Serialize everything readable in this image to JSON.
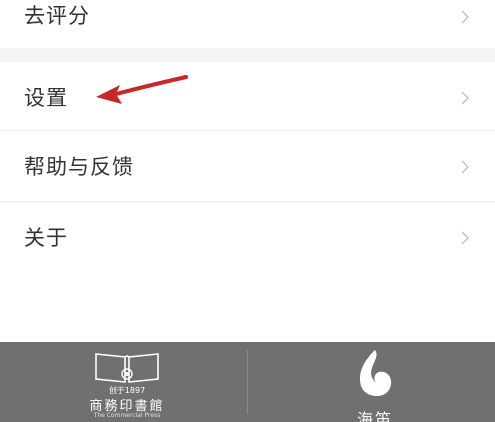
{
  "menu": {
    "items": [
      {
        "label": "去评分"
      },
      {
        "label": "设置"
      },
      {
        "label": "帮助与反馈"
      },
      {
        "label": "关于"
      }
    ]
  },
  "footer": {
    "left_logo": {
      "year_text": "创于1897",
      "name_text": "商務印書館",
      "english_text": "The Commercial Press"
    },
    "right_logo": {
      "name_text": "海笛"
    }
  },
  "icons": {
    "chevron": "chevron-right-icon",
    "annotation": "red-arrow-annotation",
    "left_logo_icon": "open-book-icon",
    "right_logo_icon": "flame-drop-icon"
  },
  "colors": {
    "annotation_arrow": "#c62828",
    "footer_bg": "#707072",
    "text": "#333333",
    "chevron": "#c4c4c4",
    "section_gap": "#f4f4f4"
  }
}
